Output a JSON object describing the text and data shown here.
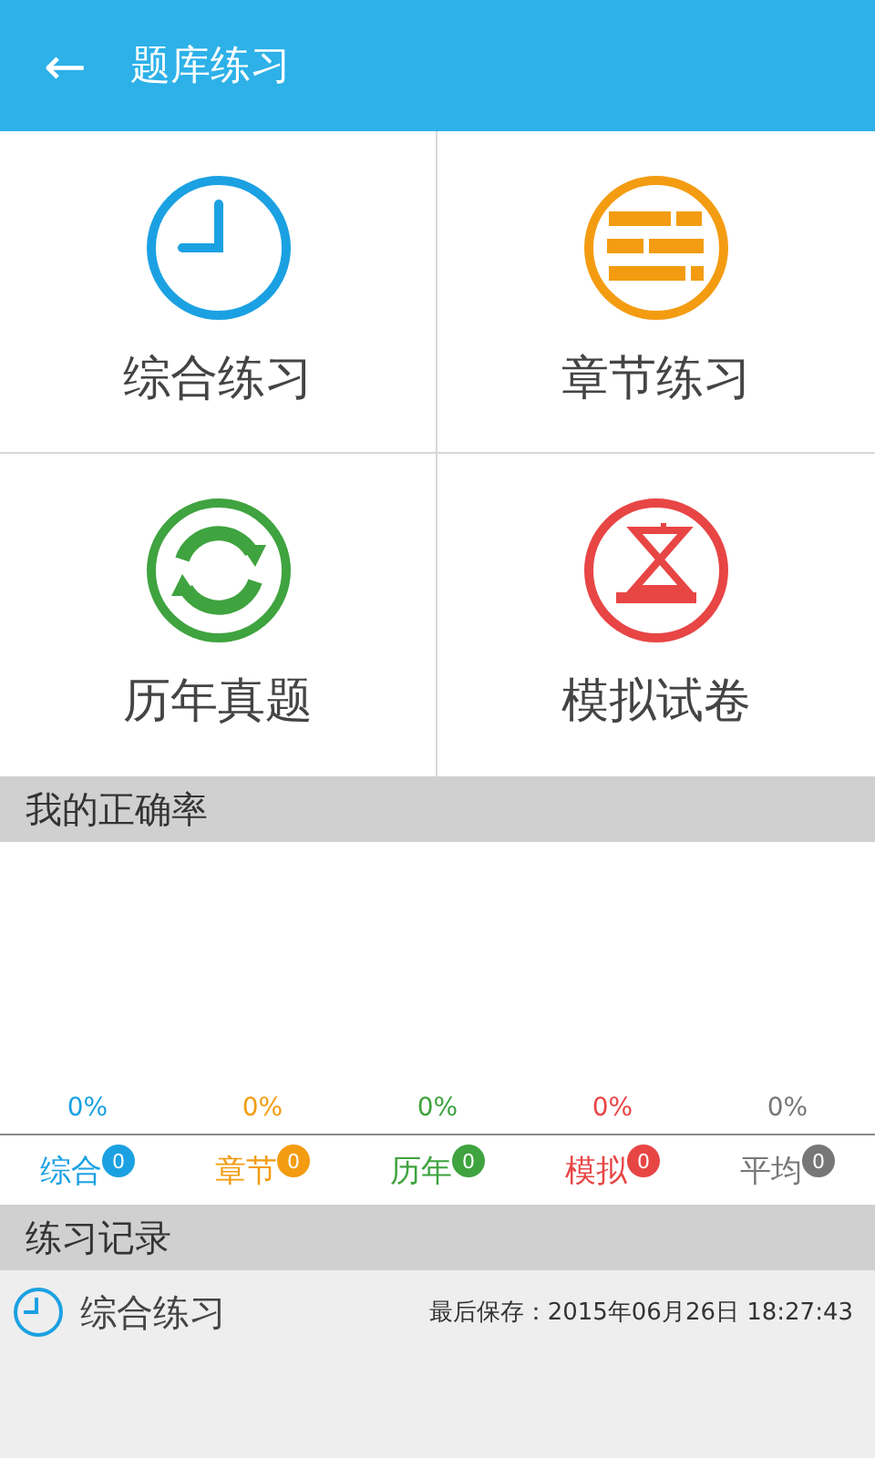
{
  "header": {
    "back_icon": "←",
    "title": "题库练习"
  },
  "tiles": [
    {
      "kind": "clock",
      "label": "综合练习",
      "color": "#1ba1e2"
    },
    {
      "kind": "lines",
      "label": "章节练习",
      "color": "#f39c12"
    },
    {
      "kind": "cycle",
      "label": "历年真题",
      "color": "#3fa33f"
    },
    {
      "kind": "paper",
      "label": "模拟试卷",
      "color": "#e84545"
    }
  ],
  "accuracy": {
    "title": "我的正确率",
    "items": [
      {
        "percent": "0%",
        "label": "综合",
        "count": "0",
        "color": "#1ba1e2"
      },
      {
        "percent": "0%",
        "label": "章节",
        "count": "0",
        "color": "#f39c12"
      },
      {
        "percent": "0%",
        "label": "历年",
        "count": "0",
        "color": "#3fa33f"
      },
      {
        "percent": "0%",
        "label": "模拟",
        "count": "0",
        "color": "#e84545"
      },
      {
        "percent": "0%",
        "label": "平均",
        "count": "0",
        "color": "#777777"
      }
    ]
  },
  "records": {
    "title": "练习记录",
    "items": [
      {
        "name": "综合练习",
        "saved": "最后保存：2015年06月26日 18:27:43"
      }
    ]
  }
}
